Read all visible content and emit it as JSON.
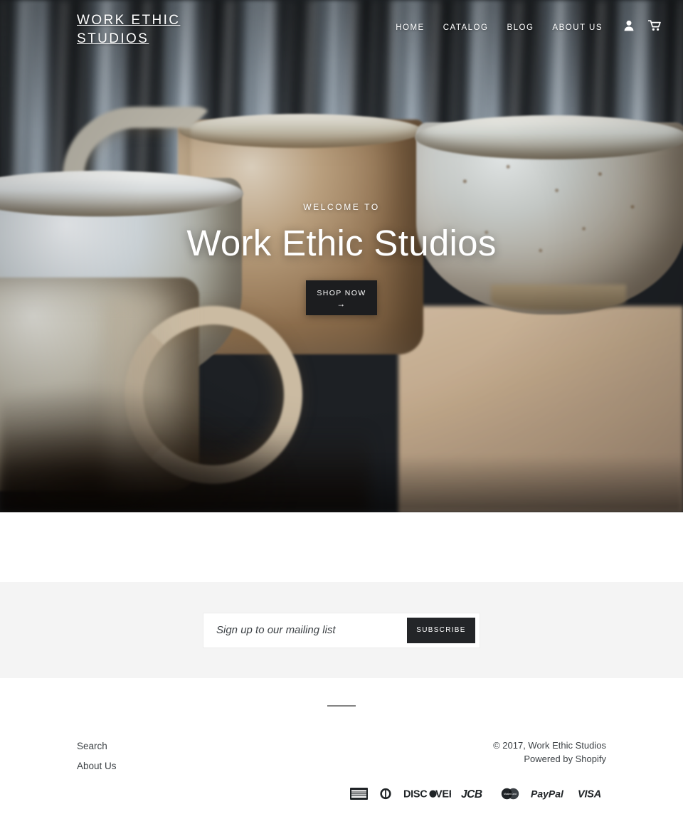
{
  "header": {
    "logo": "WORK ETHIC STUDIOS",
    "nav": [
      {
        "label": "HOME"
      },
      {
        "label": "CATALOG"
      },
      {
        "label": "BLOG"
      },
      {
        "label": "ABOUT US"
      }
    ],
    "icons": [
      {
        "name": "account-icon"
      },
      {
        "name": "cart-icon"
      }
    ]
  },
  "hero": {
    "kicker": "WELCOME TO",
    "title": "Work Ethic Studios",
    "cta_label": "SHOP NOW",
    "cta_arrow": "→",
    "image_alt": "Handmade speckled ceramic mugs and bowl on a wooden table"
  },
  "newsletter": {
    "placeholder": "Sign up to our mailing list",
    "value": "",
    "button_label": "SUBSCRIBE"
  },
  "footer": {
    "links": [
      {
        "label": "Search"
      },
      {
        "label": "About Us"
      }
    ],
    "copyright": "© 2017, Work Ethic Studios",
    "powered_prefix": "Powered by ",
    "powered_by": "Shopify",
    "payments": [
      {
        "name": "american-express-icon",
        "label": "AMERICAN EXPRESS"
      },
      {
        "name": "diners-club-icon",
        "label": "Diners Club"
      },
      {
        "name": "discover-icon",
        "label": "DISCOVER"
      },
      {
        "name": "jcb-icon",
        "label": "JCB"
      },
      {
        "name": "mastercard-icon",
        "label": "MasterCard"
      },
      {
        "name": "paypal-icon",
        "label": "PayPal"
      },
      {
        "name": "visa-icon",
        "label": "VISA"
      }
    ]
  },
  "colors": {
    "accent_dark": "#232528",
    "page_bg": "#ffffff",
    "section_bg": "#f4f4f4",
    "text": "#3d4246"
  }
}
